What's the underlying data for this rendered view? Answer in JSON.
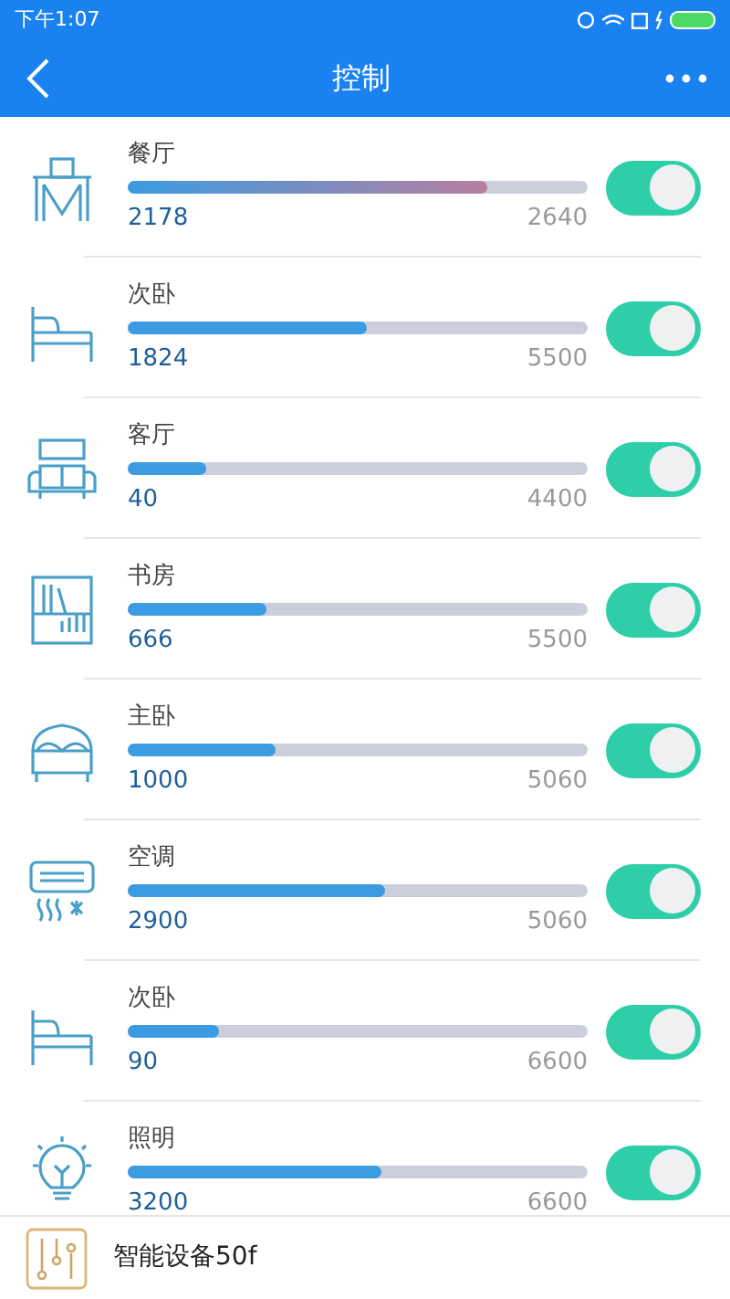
{
  "status_bar": {
    "time": "下午1:07"
  },
  "header": {
    "title": "控制"
  },
  "devices": [
    {
      "kind": "dining",
      "name": "餐厅",
      "value": "2178",
      "max": "2640",
      "level": 0.78,
      "color": "#b77f9e",
      "on": true
    },
    {
      "kind": "bed",
      "name": "次卧",
      "value": "1824",
      "max": "5500",
      "level": 0.52,
      "color": "#3b9be3",
      "on": true
    },
    {
      "kind": "sofa",
      "name": "客厅",
      "value": "40",
      "max": "4400",
      "level": 0.17,
      "color": "#3b9be3",
      "on": true
    },
    {
      "kind": "shelf",
      "name": "书房",
      "value": "666",
      "max": "5500",
      "level": 0.3,
      "color": "#3b9be3",
      "on": true
    },
    {
      "kind": "doublebed",
      "name": "主卧",
      "value": "1000",
      "max": "5060",
      "level": 0.32,
      "color": "#3b9be3",
      "on": true
    },
    {
      "kind": "ac",
      "name": "空调",
      "value": "2900",
      "max": "5060",
      "level": 0.56,
      "color": "#3b9be3",
      "on": true
    },
    {
      "kind": "bed",
      "name": "次卧",
      "value": "90",
      "max": "6600",
      "level": 0.2,
      "color": "#3b9be3",
      "on": true
    },
    {
      "kind": "bulb",
      "name": "照明",
      "value": "3200",
      "max": "6600",
      "level": 0.55,
      "color": "#3b9be3",
      "on": true
    }
  ],
  "bottom_bar": {
    "label": "智能设备50f"
  }
}
